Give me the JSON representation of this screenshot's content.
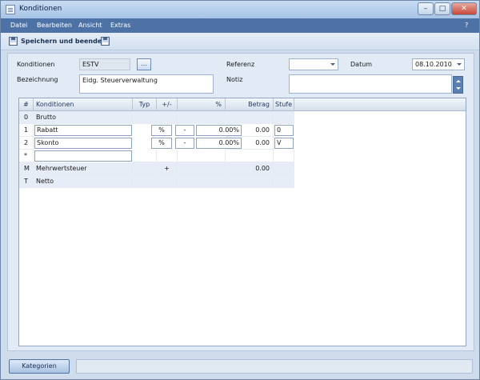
{
  "window": {
    "title": "Konditionen"
  },
  "menu": {
    "items": [
      "Datei",
      "Bearbeiten",
      "Ansicht",
      "Extras"
    ],
    "help": "?"
  },
  "toolbar": {
    "save_label": "Speichern und beenden"
  },
  "form": {
    "konditionen_label": "Konditionen",
    "konditionen_value": "ESTV",
    "ellipsis": "...",
    "bezeichnung_label": "Bezeichnung",
    "bezeichnung_value": "Eidg. Steuerverwaltung",
    "referenz_label": "Referenz",
    "referenz_value": "",
    "datum_label": "Datum",
    "datum_value": "08.10.2010",
    "notiz_label": "Notiz",
    "notiz_value": ""
  },
  "grid": {
    "columns": [
      "#",
      "Konditionen",
      "Typ",
      "+/-",
      "%",
      "Betrag",
      "Stufe"
    ],
    "rows": [
      {
        "num": "0",
        "name": "Brutto",
        "typ": "",
        "sign": "",
        "pct": "",
        "betrag": "",
        "stufe": ""
      },
      {
        "num": "1",
        "name": "Rabatt",
        "typ": "%",
        "sign": "-",
        "pct": "0.00%",
        "betrag": "0.00",
        "stufe": "0"
      },
      {
        "num": "2",
        "name": "Skonto",
        "typ": "%",
        "sign": "-",
        "pct": "0.00%",
        "betrag": "0.00",
        "stufe": "V"
      },
      {
        "num": "*",
        "name": "",
        "typ": "",
        "sign": "",
        "pct": "",
        "betrag": "",
        "stufe": ""
      },
      {
        "num": "M",
        "name": "Mehrwertsteuer",
        "typ": "",
        "sign": "+",
        "pct": "",
        "betrag": "0.00",
        "stufe": ""
      },
      {
        "num": "T",
        "name": "Netto",
        "typ": "",
        "sign": "",
        "pct": "",
        "betrag": "",
        "stufe": ""
      }
    ]
  },
  "bottom": {
    "kategorien_label": "Kategorien",
    "status_text": ""
  }
}
